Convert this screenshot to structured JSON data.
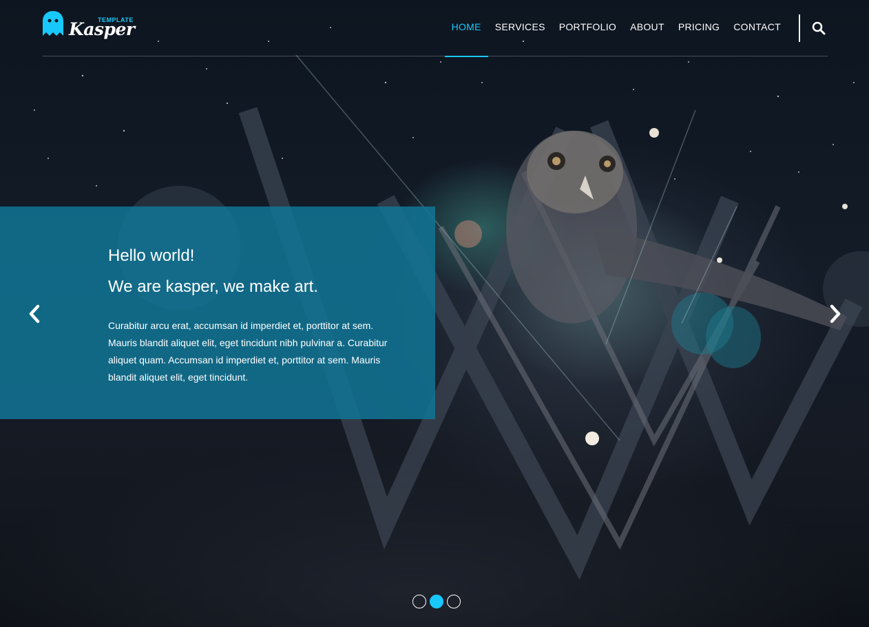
{
  "brand": {
    "logo_small": "TEMPLATE",
    "logo_main": "Kasper",
    "accent_color": "#19c8fa",
    "icon": "ghost-logo-icon"
  },
  "nav": {
    "items": [
      {
        "label": "HOME",
        "active": true
      },
      {
        "label": "SERVICES",
        "active": false
      },
      {
        "label": "PORTFOLIO",
        "active": false
      },
      {
        "label": "ABOUT",
        "active": false
      },
      {
        "label": "PRICING",
        "active": false
      },
      {
        "label": "CONTACT",
        "active": false
      }
    ],
    "search_icon": "search-icon"
  },
  "slider": {
    "title": "Hello world!",
    "subtitle": "We are kasper, we make art.",
    "text": "Curabitur arcu erat, accumsan id imperdiet et, porttitor at sem. Mauris blandit aliquet elit, eget tincidunt nibh pulvinar a. Curabitur aliquet quam. Accumsan id imperdiet et, porttitor at sem. Mauris blandit aliquet elit, eget tincidunt.",
    "box_color": "#117696",
    "prev_icon": "chevron-left-icon",
    "next_icon": "chevron-right-icon",
    "slide_count": 3,
    "active_slide": 2
  }
}
